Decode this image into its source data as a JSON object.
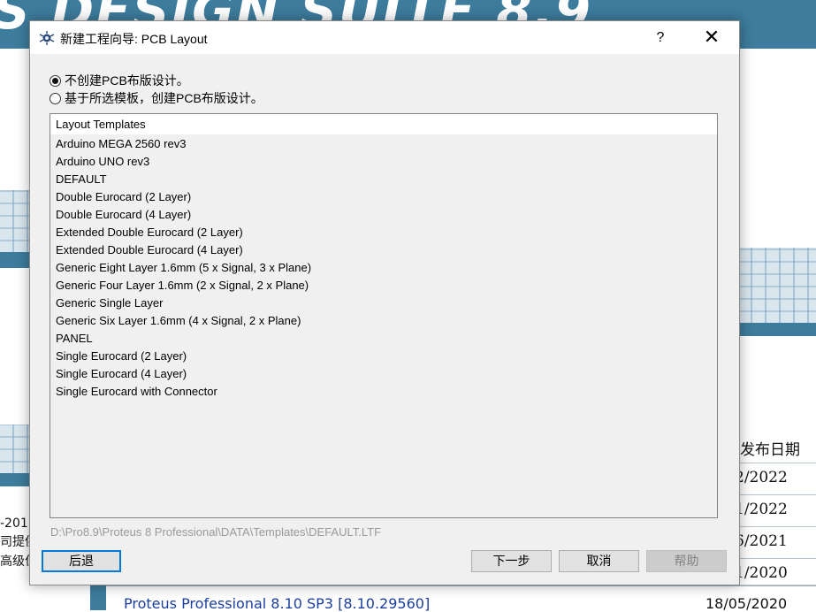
{
  "background": {
    "banner_text": "S DESIGN SUITE 8.9",
    "table_header": "发布日期",
    "dates": [
      "2/2022",
      "1/2022",
      "6/2021",
      "1/2020"
    ],
    "left_fragments": [
      "-201",
      "司提供",
      "高级位"
    ],
    "bottom_link": "Proteus Professional 8.10 SP3 [8.10.29560]",
    "bottom_date": "18/05/2020"
  },
  "dialog": {
    "title": "新建工程向导: PCB Layout",
    "help_label": "?",
    "close_label": "✕",
    "radio_options": [
      {
        "label": "不创建PCB布版设计。",
        "checked": true
      },
      {
        "label": "基于所选模板，创建PCB布版设计。",
        "checked": false
      }
    ],
    "list": {
      "header": "Layout Templates",
      "items": [
        "Arduino MEGA 2560 rev3",
        "Arduino UNO rev3",
        "DEFAULT",
        "Double Eurocard (2 Layer)",
        "Double Eurocard (4 Layer)",
        "Extended Double Eurocard (2 Layer)",
        "Extended Double Eurocard (4 Layer)",
        "Generic Eight Layer 1.6mm (5 x Signal, 3 x Plane)",
        "Generic Four Layer 1.6mm (2 x Signal, 2 x Plane)",
        "Generic Single Layer",
        "Generic Six Layer 1.6mm (4 x Signal, 2 x Plane)",
        "PANEL",
        "Single Eurocard (2 Layer)",
        "Single Eurocard (4 Layer)",
        "Single Eurocard with Connector"
      ]
    },
    "template_path": "D:\\Pro8.9\\Proteus 8 Professional\\DATA\\Templates\\DEFAULT.LTF",
    "buttons": {
      "back": "后退",
      "next": "下一步",
      "cancel": "取消",
      "help": "帮助"
    }
  }
}
